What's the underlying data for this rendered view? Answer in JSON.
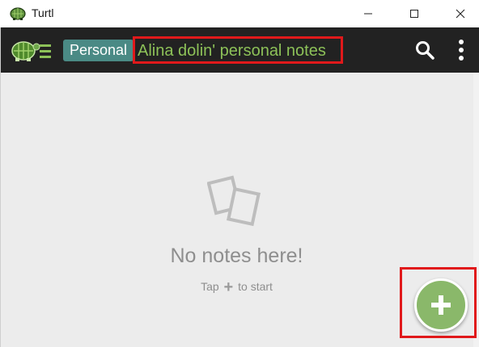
{
  "window": {
    "title": "Turtl"
  },
  "header": {
    "space_label": "Personal",
    "board_title": "Alina dolin' personal notes"
  },
  "empty_state": {
    "title": "No notes here!",
    "hint_prefix": "Tap",
    "hint_suffix": "to start"
  },
  "icons": {
    "app": "turtle-icon",
    "menu": "turtle-menu-icon",
    "search": "search-icon",
    "more": "more-vertical-icon",
    "empty": "notes-icon",
    "add": "plus-icon"
  },
  "colors": {
    "header_bg": "#222222",
    "space_badge": "#4a8a85",
    "title_text": "#8dc158",
    "fab": "#8ab86a",
    "highlight": "#e0191b",
    "content_bg": "#ececec"
  }
}
